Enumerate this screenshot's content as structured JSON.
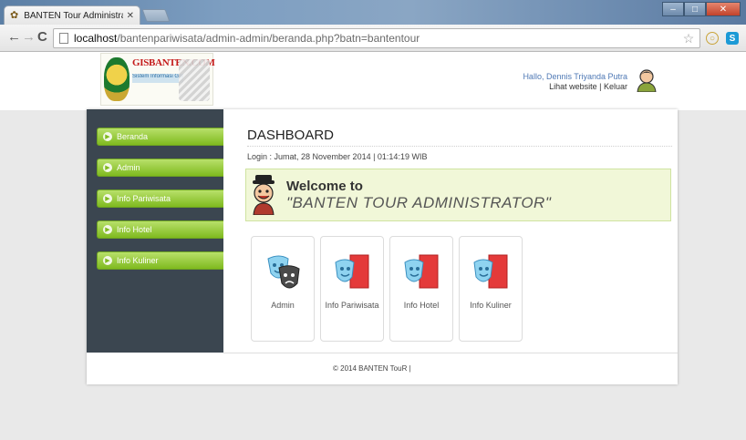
{
  "browser": {
    "tab_title": "BANTEN Tour Administra",
    "url_host": "localhost",
    "url_path": "/bantenpariwisata/admin-admin/beranda.php?batn=bantentour"
  },
  "header": {
    "logo_text": "GISBANTEN.COM",
    "logo_sub": "Sistem Informasi Geografis Banten",
    "greeting": "Hallo, Dennis Triyanda Putra",
    "link_site": "Lihat website",
    "link_sep": "|",
    "link_logout": "Keluar"
  },
  "sidebar": {
    "items": [
      {
        "label": "Beranda"
      },
      {
        "label": "Admin"
      },
      {
        "label": "Info Pariwisata"
      },
      {
        "label": "Info Hotel"
      },
      {
        "label": "Info Kuliner"
      }
    ]
  },
  "main": {
    "title": "DASHBOARD",
    "login_info": "Login : Jumat, 28 November 2014 | 01:14:19 WIB",
    "welcome_line1": "Welcome to",
    "welcome_line2": "\"BANTEN TOUR ADMINISTRATOR\"",
    "cards": [
      {
        "label": "Admin",
        "icon": "theater-masks-icon"
      },
      {
        "label": "Info Pariwisata",
        "icon": "mask-book-icon"
      },
      {
        "label": "Info Hotel",
        "icon": "mask-book-icon"
      },
      {
        "label": "Info Kuliner",
        "icon": "mask-book-icon"
      }
    ]
  },
  "footer": {
    "text": "© 2014 BANTEN TouR |"
  },
  "colors": {
    "sidebar_bg": "#3b4650",
    "menu_green": "#8cc63f",
    "welcome_bg": "#f1f7d8",
    "accent_blue": "#4f79b5"
  }
}
